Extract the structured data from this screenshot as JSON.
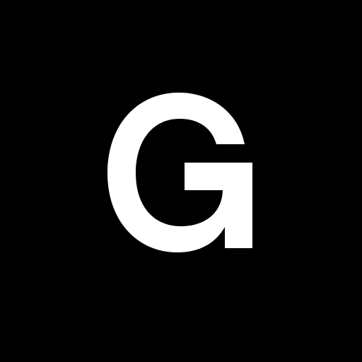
{
  "logo": {
    "letter": "G",
    "icon": "letter-g-logo-icon",
    "background_color": "#000000",
    "foreground_color": "#ffffff"
  }
}
